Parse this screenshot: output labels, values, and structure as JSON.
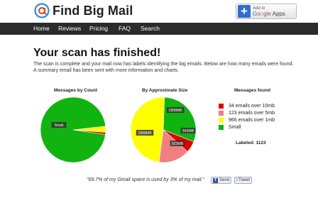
{
  "header": {
    "logo_text": "Find Big Mail",
    "logo_icon": "at-sign-icon",
    "addto": {
      "line1": "Add to",
      "line2_parts": [
        "G",
        "o",
        "o",
        "g",
        "l",
        "e"
      ],
      "line2_suffix": " Apps"
    }
  },
  "nav": {
    "items": [
      "Home",
      "Reviews",
      "Pricing",
      "FAQ",
      "Search"
    ]
  },
  "main": {
    "title": "Your scan has finished!",
    "intro": "The scan is complete and your mail now has labels identifying the big emails. Below are how many emails were found. A summary email has been sent with more information and charts."
  },
  "legend": {
    "title": "Messages found",
    "items": [
      {
        "label": "34 emails over 10mb",
        "color": "#e00000"
      },
      {
        "label": "123 emails over 5mb",
        "color": "#f08080"
      },
      {
        "label": "966 emails over 1mb",
        "color": "#ffff00"
      },
      {
        "label": "Small",
        "color": "#11b311"
      }
    ],
    "labeled": "Labeled: 1123"
  },
  "chart_data": [
    {
      "type": "pie",
      "title": "Messages by Count",
      "slices": [
        {
          "label": "Small",
          "value": 96,
          "color": "#11b311"
        },
        {
          "label": "",
          "value": 3,
          "color": "#ffff00"
        },
        {
          "label": "",
          "value": 1,
          "color": "#e00000"
        }
      ],
      "slice_labels": [
        "Small"
      ]
    },
    {
      "type": "pie",
      "title": "By Approximate Size",
      "slices": [
        {
          "label": "1808MB",
          "value": 1808,
          "color": "#11b311"
        },
        {
          "label": "342MB",
          "value": 342,
          "color": "#e00000"
        },
        {
          "label": "922MB",
          "value": 922,
          "color": "#f08080"
        },
        {
          "label": "2888MB",
          "value": 2888,
          "color": "#ffff00"
        }
      ],
      "slice_labels": [
        "1808MB",
        "342MB",
        "922MB",
        "2888MB"
      ]
    }
  ],
  "footer": {
    "quote": "\"69.7% of my Gmail space is used by 3% of my mail.\"",
    "send_label": "Send",
    "tweet_label": "Tweet",
    "facebook_icon": "facebook-icon",
    "twitter_icon": "twitter-icon"
  }
}
